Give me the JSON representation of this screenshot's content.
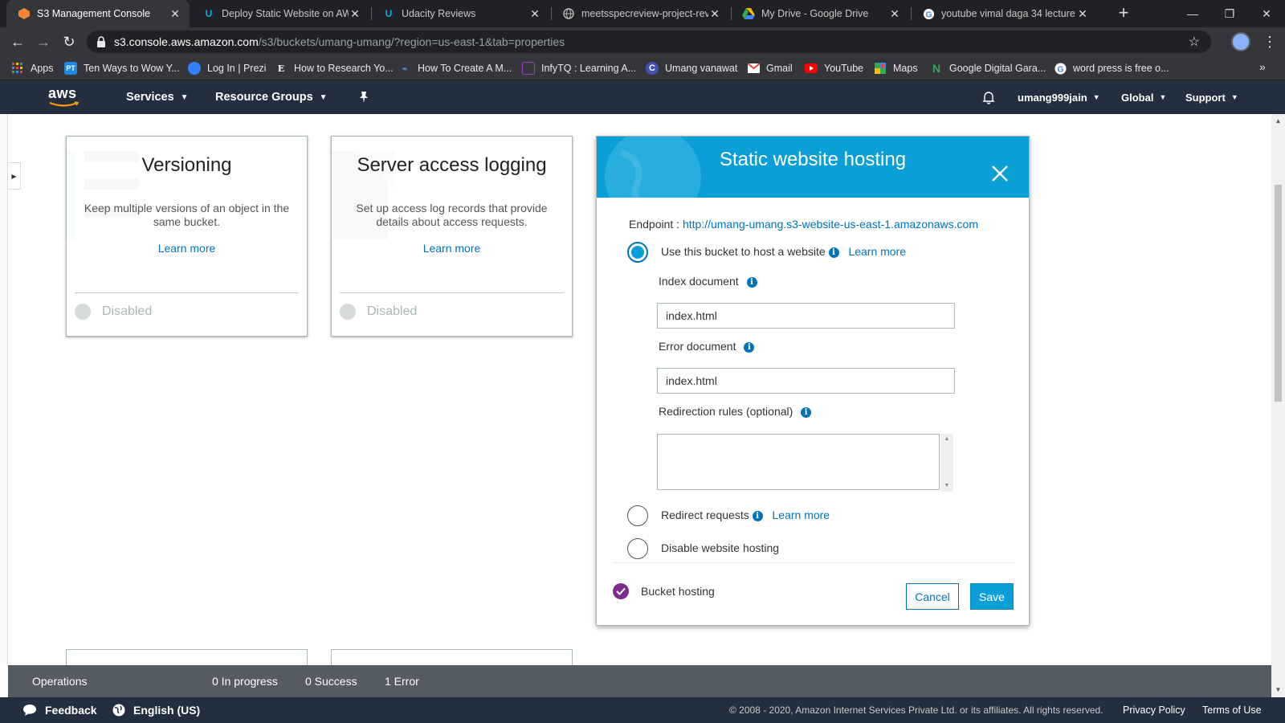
{
  "browser": {
    "tabs": [
      {
        "title": "S3 Management Console",
        "icon": "aws-s3-icon",
        "active": true
      },
      {
        "title": "Deploy Static Website on AWS",
        "icon": "udacity-icon",
        "active": false
      },
      {
        "title": "Udacity Reviews",
        "icon": "udacity-icon",
        "active": false
      },
      {
        "title": "meetsspecreview-project-revie",
        "icon": "globe-icon",
        "active": false
      },
      {
        "title": "My Drive - Google Drive",
        "icon": "google-drive-icon",
        "active": false
      },
      {
        "title": "youtube vimal daga 34 lecture",
        "icon": "google-icon",
        "active": false
      }
    ],
    "new_tab": "+",
    "url_host": "s3.console.aws.amazon.com",
    "url_path": "/s3/buckets/umang-umang/?region=us-east-1&tab=properties",
    "bookmarks": [
      {
        "label": "Apps",
        "icon": "apps-grid-icon"
      },
      {
        "label": "Ten Ways to Wow Y...",
        "icon": "pt-icon"
      },
      {
        "label": "Log In | Prezi",
        "icon": "prezi-icon"
      },
      {
        "label": "How to Research Yo...",
        "icon": "e-icon"
      },
      {
        "label": "How To Create A M...",
        "icon": "bird-icon"
      },
      {
        "label": "InfyTQ : Learning A...",
        "icon": "infytq-icon"
      },
      {
        "label": "Umang vanawat",
        "icon": "c-icon"
      },
      {
        "label": "Gmail",
        "icon": "gmail-icon"
      },
      {
        "label": "YouTube",
        "icon": "youtube-icon"
      },
      {
        "label": "Maps",
        "icon": "maps-icon"
      },
      {
        "label": "Google Digital Gara...",
        "icon": "n-icon"
      },
      {
        "label": "word press is free o...",
        "icon": "google-icon"
      }
    ],
    "bookmarks_more": "»"
  },
  "aws_nav": {
    "logo": "aws",
    "services": "Services",
    "resource_groups": "Resource Groups",
    "user": "umang999jain",
    "region": "Global",
    "support": "Support"
  },
  "cards": [
    {
      "title": "Versioning",
      "description": "Keep multiple versions of an object in the same bucket.",
      "learn_more": "Learn more",
      "status": "Disabled"
    },
    {
      "title": "Server access logging",
      "description": "Set up access log records that provide details about access requests.",
      "learn_more": "Learn more",
      "status": "Disabled"
    }
  ],
  "static_hosting": {
    "title": "Static website hosting",
    "endpoint_label": "Endpoint :",
    "endpoint_url": "http://umang-umang.s3-website-us-east-1.amazonaws.com",
    "option_host": "Use this bucket to host a website",
    "learn_more": "Learn more",
    "index_label": "Index document",
    "index_value": "index.html",
    "error_label": "Error document",
    "error_value": "index.html",
    "redirection_label": "Redirection rules (optional)",
    "redirection_value": "",
    "option_redirect": "Redirect requests",
    "option_disable": "Disable website hosting",
    "selected_option": "host",
    "bucket_hosting": "Bucket hosting",
    "cancel": "Cancel",
    "save": "Save"
  },
  "operations": {
    "label": "Operations",
    "in_progress": "0 In progress",
    "success": "0 Success",
    "error": "1 Error"
  },
  "footer": {
    "feedback": "Feedback",
    "language": "English (US)",
    "copyright": "© 2008 - 2020, Amazon Internet Services Private Ltd. or its affiliates. All rights reserved.",
    "privacy": "Privacy Policy",
    "terms": "Terms of Use"
  },
  "colors": {
    "aws_nav": "#232f3e",
    "header_blue": "#0aa0d7",
    "link_blue": "#0073bb",
    "check_purple": "#7b2d8b",
    "ops_bar": "#545b64"
  }
}
